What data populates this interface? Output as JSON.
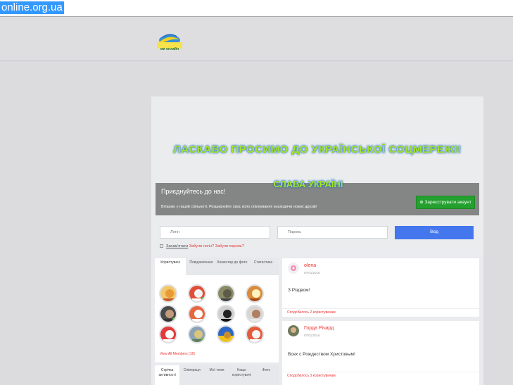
{
  "browser": {
    "url": "online.org.ua"
  },
  "header": {
    "logo_text": "ми онлайн"
  },
  "hero": {
    "title": "ЛАСКАВО ПРОСИМО ДО УКРАЇНСЬКОЇ СОЦМЕРЕЖІ!",
    "subtitle": "СЛАВА УКРАЇНІ"
  },
  "join": {
    "title": "Приєднуйтесь до нас!",
    "description": "Вітаємо у нашій спільноті. Розширюйте своє коло спілкування знаходячи нових друзів!",
    "register_label": "⊕ Зареєструвати акаунт"
  },
  "login": {
    "login_placeholder": "Логін",
    "password_placeholder": "Пароль",
    "submit_label": "Вхід",
    "remember_label": "Запам'ятати",
    "forgot_login": "Забули логін?",
    "forgot_password": "Забули пароль?"
  },
  "users_panel": {
    "tabs": [
      "Користувачі",
      "Повідомлення",
      "Коментар до фото",
      "Статистика"
    ],
    "view_all": "View All Members (16)"
  },
  "activity_tabs": [
    "Стрічка активності",
    "Співпраця",
    "Мої теми",
    "Нащо користувачі",
    "Фото"
  ],
  "posts": [
    {
      "author": "olena",
      "time": "07/01/2016",
      "text": "З Різдвом!",
      "footer": "Сподобалось 2 користувачам"
    },
    {
      "author": "Горда Річард",
      "time": "07/01/2016",
      "text": "Всех с Рождеством Христовым!",
      "footer": "Сподобалось 3 користувачам"
    }
  ],
  "colors": {
    "accent_red": "#e33333",
    "register_green": "#23a02e",
    "login_blue": "#4477ee",
    "hero_text": "#a5e22a"
  }
}
